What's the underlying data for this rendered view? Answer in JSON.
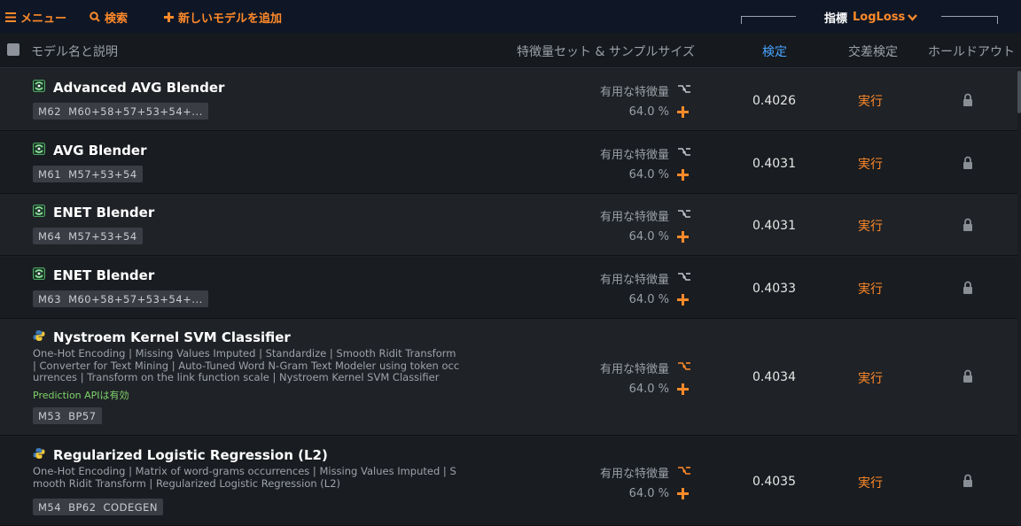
{
  "toolbar": {
    "menu_label": "メニュー",
    "search_label": "検索",
    "add_model_label": "新しいモデルを追加",
    "metric_label": "指標",
    "metric_value": "LogLoss"
  },
  "columns": {
    "name": "モデル名と説明",
    "featureset": "特徴量セット & サンプルサイズ",
    "validation": "検定",
    "cross_validation": "交差検定",
    "holdout": "ホールドアウト"
  },
  "colors": {
    "accent": "#ff8a2a",
    "active_header": "#4aa3ff",
    "api_text": "#7fd36b"
  },
  "models": [
    {
      "name": "Advanced AVG Blender",
      "icon": "blender-icon",
      "tags": [
        "M62",
        "M60+58+57+53+54+..."
      ],
      "feature_list": "有用な特徴量",
      "sample_pct": "64.0 %",
      "validation": "0.4026",
      "cv_action": "実行"
    },
    {
      "name": "AVG Blender",
      "icon": "blender-icon",
      "tags": [
        "M61",
        "M57+53+54"
      ],
      "feature_list": "有用な特徴量",
      "sample_pct": "64.0 %",
      "validation": "0.4031",
      "cv_action": "実行"
    },
    {
      "name": "ENET Blender",
      "icon": "blender-icon",
      "tags": [
        "M64",
        "M57+53+54"
      ],
      "feature_list": "有用な特徴量",
      "sample_pct": "64.0 %",
      "validation": "0.4031",
      "cv_action": "実行"
    },
    {
      "name": "ENET Blender",
      "icon": "blender-icon",
      "tags": [
        "M63",
        "M60+58+57+53+54+..."
      ],
      "feature_list": "有用な特徴量",
      "sample_pct": "64.0 %",
      "validation": "0.4033",
      "cv_action": "実行"
    },
    {
      "name": "Nystroem Kernel SVM Classifier",
      "icon": "python-icon",
      "description": "One-Hot Encoding | Missing Values Imputed | Standardize | Smooth Ridit Transform | Converter for Text Mining | Auto-Tuned Word N-Gram Text Modeler using token occurrences | Transform on the link function scale | Nystroem Kernel SVM Classifier",
      "api_note": "Prediction APIは有効",
      "tags": [
        "M53",
        "BP57"
      ],
      "feature_list": "有用な特徴量",
      "sample_pct": "64.0 %",
      "validation": "0.4034",
      "cv_action": "実行"
    },
    {
      "name": "Regularized Logistic Regression (L2)",
      "icon": "python-icon",
      "description": "One-Hot Encoding | Matrix of word-grams occurrences | Missing Values Imputed | Smooth Ridit Transform | Regularized Logistic Regression (L2)",
      "tags": [
        "M54",
        "BP62",
        "CODEGEN"
      ],
      "feature_list": "有用な特徴量",
      "sample_pct": "64.0 %",
      "validation": "0.4035",
      "cv_action": "実行"
    }
  ]
}
